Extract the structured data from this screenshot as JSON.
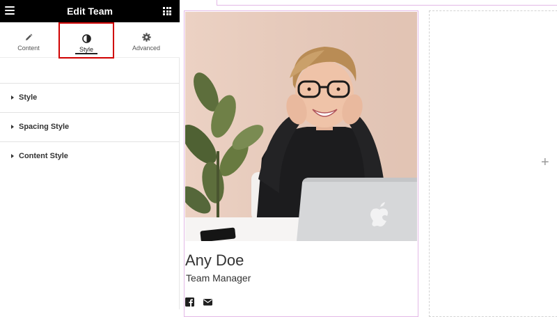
{
  "panel": {
    "title": "Edit Team",
    "tabs": [
      {
        "label": "Content",
        "icon": "pencil-icon"
      },
      {
        "label": "Style",
        "icon": "half-circle-icon",
        "active": true
      },
      {
        "label": "Advanced",
        "icon": "gear-icon"
      }
    ],
    "sections": [
      {
        "label": "Style"
      },
      {
        "label": "Spacing Style"
      },
      {
        "label": "Content Style"
      }
    ]
  },
  "canvas": {
    "member": {
      "name": "Any Doe",
      "role": "Team Manager",
      "social": [
        "facebook-icon",
        "email-icon"
      ]
    },
    "add_icon": "+"
  },
  "colors": {
    "topbar": "#000000",
    "active_tab_outline": "#d00000",
    "selection_border": "#e3b8e6",
    "empty_column_border": "#d2d2d2"
  }
}
